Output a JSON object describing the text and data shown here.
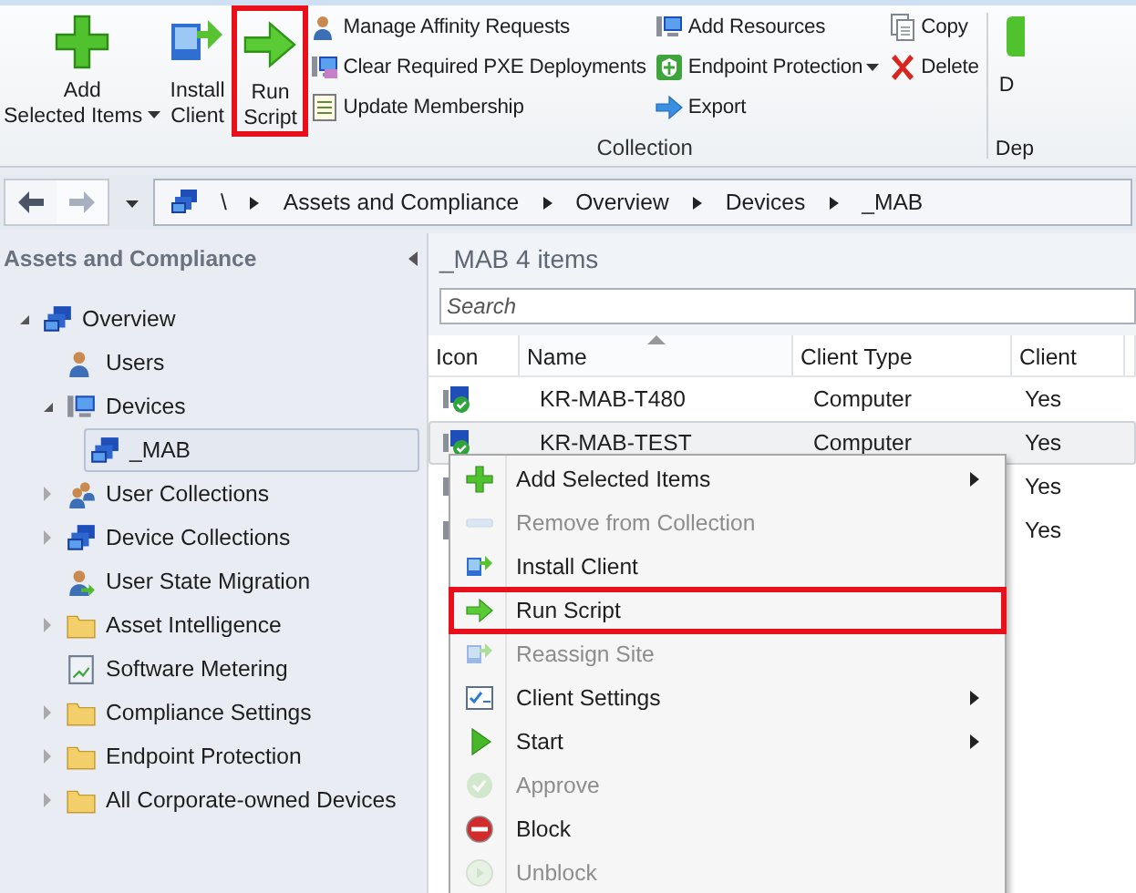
{
  "ribbon": {
    "large_buttons": [
      {
        "lines": [
          "Add",
          "Selected Items"
        ],
        "dropdown": true,
        "highlighted": false
      },
      {
        "lines": [
          "Install",
          "Client"
        ],
        "dropdown": false,
        "highlighted": false
      },
      {
        "lines": [
          "Run",
          "Script"
        ],
        "dropdown": false,
        "highlighted": true
      }
    ],
    "small_columns": [
      [
        {
          "label": "Manage Affinity Requests",
          "dropdown": false
        },
        {
          "label": "Clear Required PXE Deployments",
          "dropdown": false
        },
        {
          "label": "Update Membership",
          "dropdown": false
        }
      ],
      [
        {
          "label": "Add Resources",
          "dropdown": false
        },
        {
          "label": "Endpoint Protection",
          "dropdown": true
        },
        {
          "label": "Export",
          "dropdown": false
        }
      ],
      [
        {
          "label": "Copy",
          "dropdown": false
        },
        {
          "label": "Delete",
          "dropdown": false
        }
      ]
    ],
    "group_label": "Collection",
    "next_group": {
      "button_label": "D",
      "label": "Dep"
    }
  },
  "navigation": {
    "path": [
      "\\",
      "Assets and Compliance",
      "Overview",
      "Devices",
      "_MAB"
    ]
  },
  "sidebar": {
    "title": "Assets and Compliance",
    "tree": [
      {
        "label": "Overview",
        "expanded": true,
        "selected": false,
        "children": [
          {
            "label": "Users",
            "selected": false
          },
          {
            "label": "Devices",
            "expanded": true,
            "selected": false,
            "children": [
              {
                "label": "_MAB",
                "selected": true
              }
            ]
          },
          {
            "label": "User Collections",
            "expanded": false,
            "selected": false
          },
          {
            "label": "Device Collections",
            "expanded": false,
            "selected": false
          },
          {
            "label": "User State Migration",
            "selected": false
          },
          {
            "label": "Asset Intelligence",
            "expanded": false,
            "selected": false
          },
          {
            "label": "Software Metering",
            "selected": false
          },
          {
            "label": "Compliance Settings",
            "expanded": false,
            "selected": false
          },
          {
            "label": "Endpoint Protection",
            "expanded": false,
            "selected": false
          },
          {
            "label": "All Corporate-owned Devices",
            "expanded": false,
            "selected": false
          }
        ]
      }
    ]
  },
  "content": {
    "title": "_MAB 4 items",
    "search": {
      "placeholder": "Search"
    },
    "table": {
      "columns": [
        {
          "label": "Icon",
          "sorted": false
        },
        {
          "label": "Name",
          "sorted": true
        },
        {
          "label": "Client Type",
          "sorted": false
        },
        {
          "label": "Client",
          "sorted": false
        }
      ],
      "rows": [
        {
          "name": "KR-MAB-T480",
          "client_type": "Computer",
          "client": "Yes",
          "selected": false
        },
        {
          "name": "KR-MAB-TEST",
          "client_type": "Computer",
          "client": "Yes",
          "selected": true
        },
        {
          "client": "Yes",
          "selected": false
        },
        {
          "client": "Yes",
          "selected": false
        }
      ]
    }
  },
  "context_menu": {
    "items": [
      {
        "label": "Add Selected Items",
        "disabled": false,
        "submenu": true,
        "highlighted": false
      },
      {
        "label": "Remove from Collection",
        "disabled": true,
        "submenu": false,
        "highlighted": false
      },
      {
        "label": "Install Client",
        "disabled": false,
        "submenu": false,
        "highlighted": false
      },
      {
        "label": "Run Script",
        "disabled": false,
        "submenu": false,
        "highlighted": true
      },
      {
        "label": "Reassign Site",
        "disabled": true,
        "submenu": false,
        "highlighted": false
      },
      {
        "label": "Client Settings",
        "disabled": false,
        "submenu": true,
        "highlighted": false
      },
      {
        "label": "Start",
        "disabled": false,
        "submenu": true,
        "highlighted": false
      },
      {
        "label": "Approve",
        "disabled": true,
        "submenu": false,
        "highlighted": false
      },
      {
        "label": "Block",
        "disabled": false,
        "submenu": false,
        "highlighted": false
      },
      {
        "label": "Unblock",
        "disabled": true,
        "submenu": false,
        "highlighted": false
      }
    ]
  }
}
